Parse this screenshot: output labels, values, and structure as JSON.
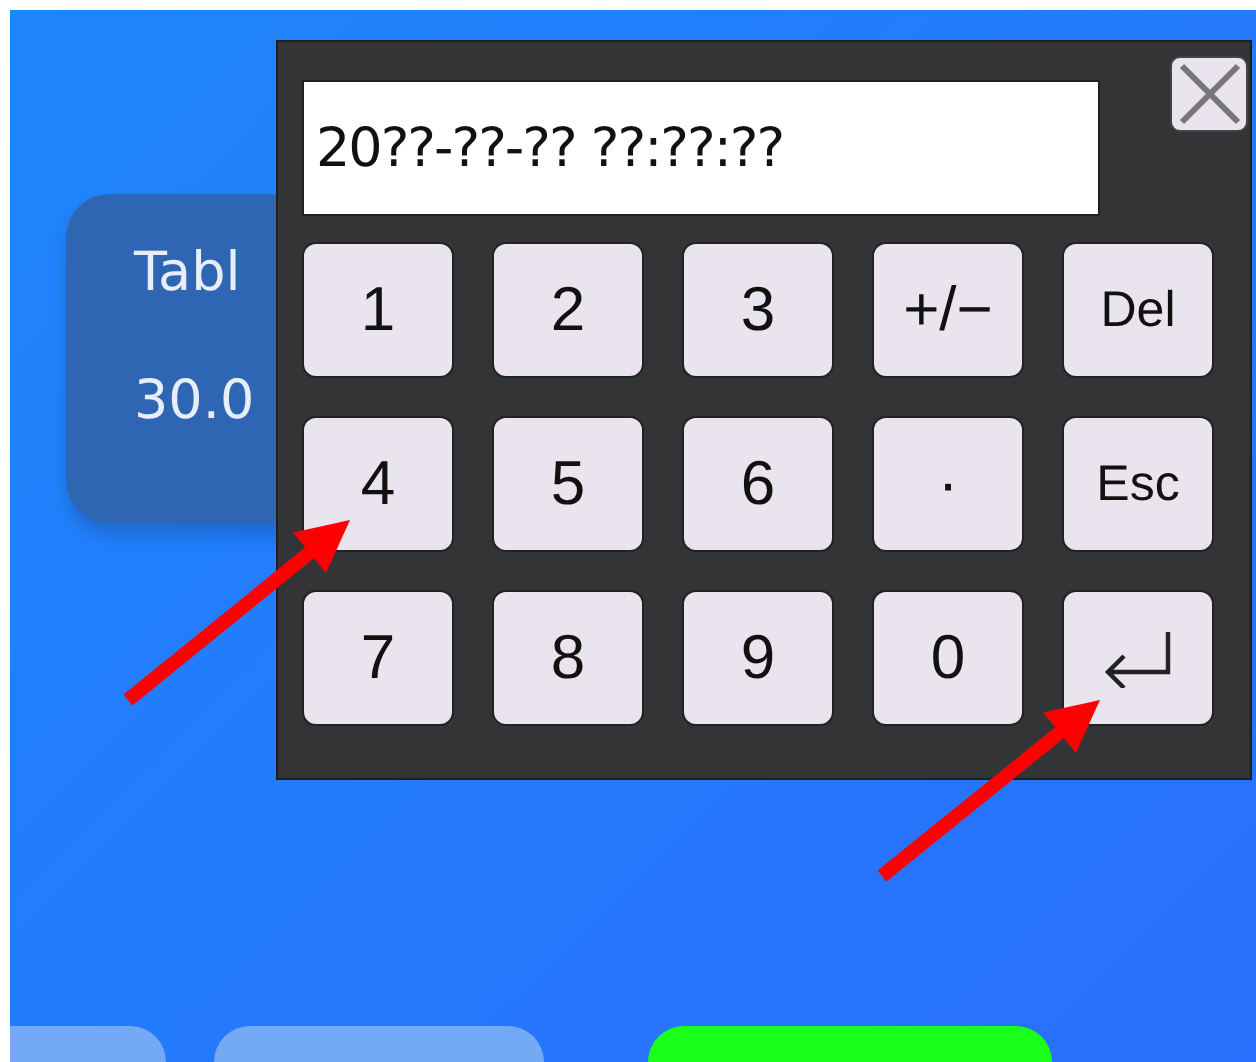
{
  "background_card": {
    "label": "Tabl",
    "value": "30.0"
  },
  "keypad": {
    "display": "20??-??-?? ??:??:??",
    "keys": [
      {
        "kind": "text",
        "label": "1"
      },
      {
        "kind": "text",
        "label": "2"
      },
      {
        "kind": "text",
        "label": "3"
      },
      {
        "kind": "text",
        "label": "+/−"
      },
      {
        "kind": "text",
        "label": "Del"
      },
      {
        "kind": "text",
        "label": "4"
      },
      {
        "kind": "text",
        "label": "5"
      },
      {
        "kind": "text",
        "label": "6"
      },
      {
        "kind": "text",
        "label": "·"
      },
      {
        "kind": "text",
        "label": "Esc"
      },
      {
        "kind": "text",
        "label": "7"
      },
      {
        "kind": "text",
        "label": "8"
      },
      {
        "kind": "text",
        "label": "9"
      },
      {
        "kind": "text",
        "label": "0"
      },
      {
        "kind": "enter"
      }
    ]
  },
  "bottom_buttons": [
    {
      "color": "#74aaf5"
    },
    {
      "color": "#74aaf5"
    },
    {
      "color": "#19ff19"
    }
  ]
}
